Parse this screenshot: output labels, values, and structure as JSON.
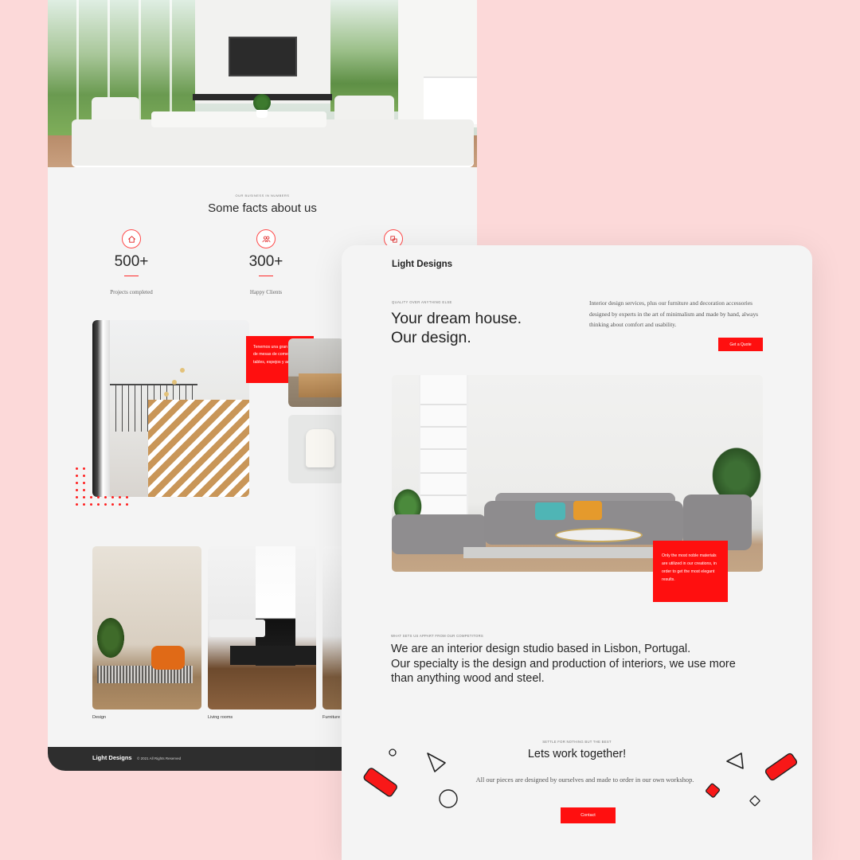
{
  "back_page": {
    "facts": {
      "eyebrow": "OUR BUSINESS IN NUMBERS",
      "title": "Some facts about us",
      "stats": [
        {
          "icon": "home-icon",
          "value": "500+",
          "label": "Projects completed"
        },
        {
          "icon": "users-icon",
          "value": "300+",
          "label": "Happy Clients"
        },
        {
          "icon": "furniture-icon"
        }
      ]
    },
    "gallery": {
      "note": "Tenemos una gran coleccion de mesas de comedor, coffee tables, espejos y accesorios."
    },
    "categories": [
      {
        "label": "Design"
      },
      {
        "label": "Living rooms"
      },
      {
        "label": "Furniture"
      }
    ],
    "footer": {
      "brand": "Light Designs",
      "copyright": "© 2021 All Rights Reserved"
    }
  },
  "front_page": {
    "brand": "Light Designs",
    "hero": {
      "eyebrow": "QUALITY OVER ANYTHING ELSE",
      "headline_line1": "Your dream house.",
      "headline_line2": "Our design.",
      "intro": "Interior design services, plus our furniture and decoration accessories designed by experts in the art of minimalism and made by hand, always thinking about comfort and usability.",
      "cta_label": "Get a Quote"
    },
    "photo_note": "Only the most noble materials are utilized in our creations, in order to get the most elegant results.",
    "about": {
      "eyebrow": "WHAT SETS US APPART FROM OUR COMPETITORS",
      "line1": "We are an interior design studio based in Lisbon, Portugal.",
      "line2": "Our specialty is the design and production of interiors, we use more than anything wood and steel."
    },
    "work": {
      "eyebrow": "SETTLE FOR NOTHING BUT THE BEST",
      "title": "Lets work together!",
      "text": "All our pieces are designed by ourselves and made to order in our own workshop.",
      "cta_label": "Contact"
    }
  },
  "colors": {
    "background": "#fcd9d9",
    "accent": "#ff0f0f",
    "page": "#f4f4f4",
    "footer": "#2e2e2e"
  }
}
